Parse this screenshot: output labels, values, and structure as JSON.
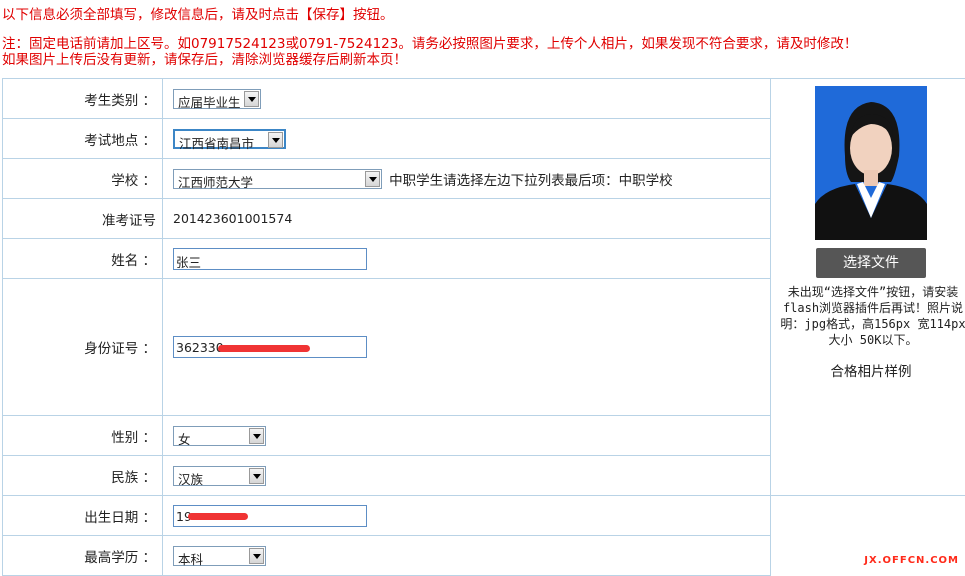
{
  "notices": {
    "line1": "以下信息必须全部填写，修改信息后，请及时点击【保存】按钮。",
    "line2": "注：固定电话前请加上区号。如07917524123或0791-7524123。请务必按照图片要求，上传个人相片，如果发现不符合要求，请及时修改！",
    "line3": "如果图片上传后没有更新，请保存后，清除浏览器缓存后刷新本页！"
  },
  "form": {
    "category_label": "考生类别 ：",
    "category_value": "应届毕业生",
    "location_label": "考试地点 ：",
    "location_value": "江西省南昌市",
    "school_label": "学校 ：",
    "school_value": "江西师范大学",
    "school_hint": "中职学生请选择左边下拉列表最后项：中职学校",
    "exam_no_label": "准考证号",
    "exam_no_value": "201423601001574",
    "name_label": "姓名 ：",
    "name_value": "张三",
    "id_label": "身份证号 ：",
    "id_value": "362330",
    "gender_label": "性别 ：",
    "gender_value": "女",
    "ethnicity_label": "民族 ：",
    "ethnicity_value": "汉族",
    "birth_label": "出生日期 ：",
    "birth_value": "19",
    "education_label": "最高学历 ：",
    "education_value": "本科"
  },
  "photo": {
    "choose_button": "选择文件",
    "note": "未出现“选择文件”按钮，请安装flash浏览器插件后再试！照片说明：jpg格式，高156px 宽114px 大小 50K以下。",
    "sample_label": "合格相片样例"
  },
  "watermark": "JX.OFFCN.COM",
  "colors": {
    "notice_red": "#e00000",
    "border_blue": "#b9d3e6",
    "photo_bg": "#1f6ad9",
    "button_gray": "#565656"
  }
}
